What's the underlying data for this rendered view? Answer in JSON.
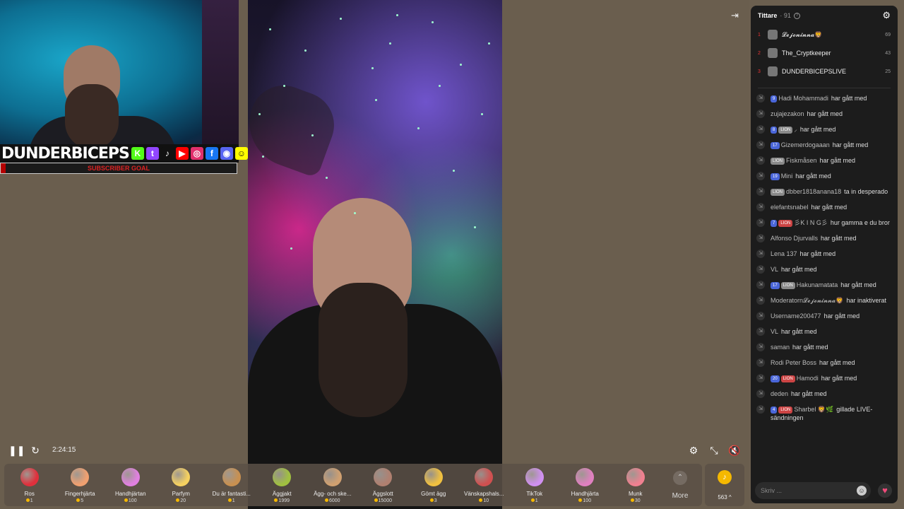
{
  "overlay": {
    "brand": "DUNDERBICEPS",
    "sub_goal": "SUBSCRIBER GOAL",
    "socials": [
      {
        "icon": "kick-icon",
        "glyph": "K",
        "color": "#53fc18"
      },
      {
        "icon": "twitch-icon",
        "glyph": "t",
        "color": "#9146ff"
      },
      {
        "icon": "tiktok-icon",
        "glyph": "♪",
        "color": "#111"
      },
      {
        "icon": "youtube-icon",
        "glyph": "▶",
        "color": "#ff0000"
      },
      {
        "icon": "instagram-icon",
        "glyph": "◎",
        "color": "#e1306c"
      },
      {
        "icon": "facebook-icon",
        "glyph": "f",
        "color": "#1877f2"
      },
      {
        "icon": "discord-icon",
        "glyph": "◉",
        "color": "#5865f2"
      },
      {
        "icon": "snapchat-icon",
        "glyph": "☺",
        "color": "#fffc00"
      }
    ]
  },
  "player": {
    "time": "2:24:15"
  },
  "gifts": [
    {
      "name": "Ros",
      "price": "1",
      "color": "#e0303c"
    },
    {
      "name": "Fingerhjärta",
      "price": "5",
      "color": "#f0a070"
    },
    {
      "name": "Handhjärtan",
      "price": "100",
      "color": "#e080e0"
    },
    {
      "name": "Parfym",
      "price": "20",
      "color": "#f4d060"
    },
    {
      "name": "Du är fantasti...",
      "price": "1",
      "color": "#c89050"
    },
    {
      "name": "Äggjakt",
      "price": "1999",
      "color": "#a0c040"
    },
    {
      "name": "Ägg- och ske...",
      "price": "6000",
      "color": "#d0a070"
    },
    {
      "name": "Äggslott",
      "price": "15000",
      "color": "#b08070"
    },
    {
      "name": "Gömt ägg",
      "price": "3",
      "color": "#f0c040"
    },
    {
      "name": "Vänskapshals...",
      "price": "10",
      "color": "#d05050"
    },
    {
      "name": "TikTok",
      "price": "1",
      "color": "#d090f0"
    },
    {
      "name": "Handhjärta",
      "price": "100",
      "color": "#e080c0"
    },
    {
      "name": "Munk",
      "price": "30",
      "color": "#f08090"
    }
  ],
  "more_label": "More",
  "coins": {
    "count": "563 ^"
  },
  "panel": {
    "title": "Tittare",
    "count": "· 91",
    "viewers": [
      {
        "rank": "1",
        "name": "𝓛𝓮𝓳𝓸𝓷𝓲𝓷𝓷𝓪🦁",
        "score": "69"
      },
      {
        "rank": "2",
        "name": "The_Cryptkeeper",
        "score": "43"
      },
      {
        "rank": "3",
        "name": "DUNDERBICEPSLIVE",
        "score": "25"
      }
    ],
    "messages": [
      {
        "badges": [
          [
            "b-blue",
            "9"
          ]
        ],
        "user": "Hadi Mohammadi",
        "action": "har gått med"
      },
      {
        "badges": [],
        "user": "zujajezakon",
        "action": "har gått med"
      },
      {
        "badges": [
          [
            "b-blue",
            "8"
          ],
          [
            "b-gray",
            "LION"
          ]
        ],
        "user": "⸝",
        "action": "har gått med"
      },
      {
        "badges": [
          [
            "b-blue",
            "17"
          ]
        ],
        "user": "Gizemerdogaaan",
        "action": "har gått med"
      },
      {
        "badges": [
          [
            "b-gray",
            "LION"
          ]
        ],
        "user": "Fiskmåsen",
        "action": "har gått med"
      },
      {
        "badges": [
          [
            "b-blue",
            "19"
          ]
        ],
        "user": "Mini",
        "action": "har gått med"
      },
      {
        "badges": [
          [
            "b-gray",
            "LION"
          ]
        ],
        "user": "dbber1818anana18",
        "action": "ta in desperado"
      },
      {
        "badges": [],
        "user": "elefantsnabel",
        "action": "har gått med"
      },
      {
        "badges": [
          [
            "b-blue",
            "7"
          ],
          [
            "b-red",
            "LION"
          ]
        ],
        "user": "彡K I N G彡",
        "action": "hur gamma e du bror"
      },
      {
        "badges": [],
        "user": "Alfonso Djurvalls",
        "action": "har gått med"
      },
      {
        "badges": [],
        "user": "Lena 137",
        "action": "har gått med"
      },
      {
        "badges": [],
        "user": "VL",
        "action": "har gått med"
      },
      {
        "badges": [
          [
            "b-blue",
            "17"
          ],
          [
            "b-gray",
            "LION"
          ]
        ],
        "user": "Hakunamatata",
        "action": "har gått med"
      },
      {
        "badges": [],
        "user": "Moderatorn𝓛𝓮𝓳𝓸𝓷𝓲𝓷𝓷𝓪🦁",
        "action": "har inaktiverat"
      },
      {
        "badges": [],
        "user": "Username200477",
        "action": "har gått med"
      },
      {
        "badges": [],
        "user": "VL",
        "action": "har gått med"
      },
      {
        "badges": [],
        "user": "saman",
        "action": "har gått med"
      },
      {
        "badges": [],
        "user": "Rodi Peter Boss",
        "action": "har gått med"
      },
      {
        "badges": [
          [
            "b-blue",
            "20"
          ],
          [
            "b-red",
            "LION"
          ]
        ],
        "user": "Hamodi",
        "action": "har gått med"
      },
      {
        "badges": [],
        "user": "deden",
        "action": "har gått med"
      },
      {
        "badges": [
          [
            "b-blue",
            "4"
          ],
          [
            "b-red",
            "LION"
          ]
        ],
        "user": "Sharbel 🦁🌿",
        "action": "gillade LIVE-sändningen"
      }
    ],
    "input_placeholder": "Skriv ..."
  }
}
